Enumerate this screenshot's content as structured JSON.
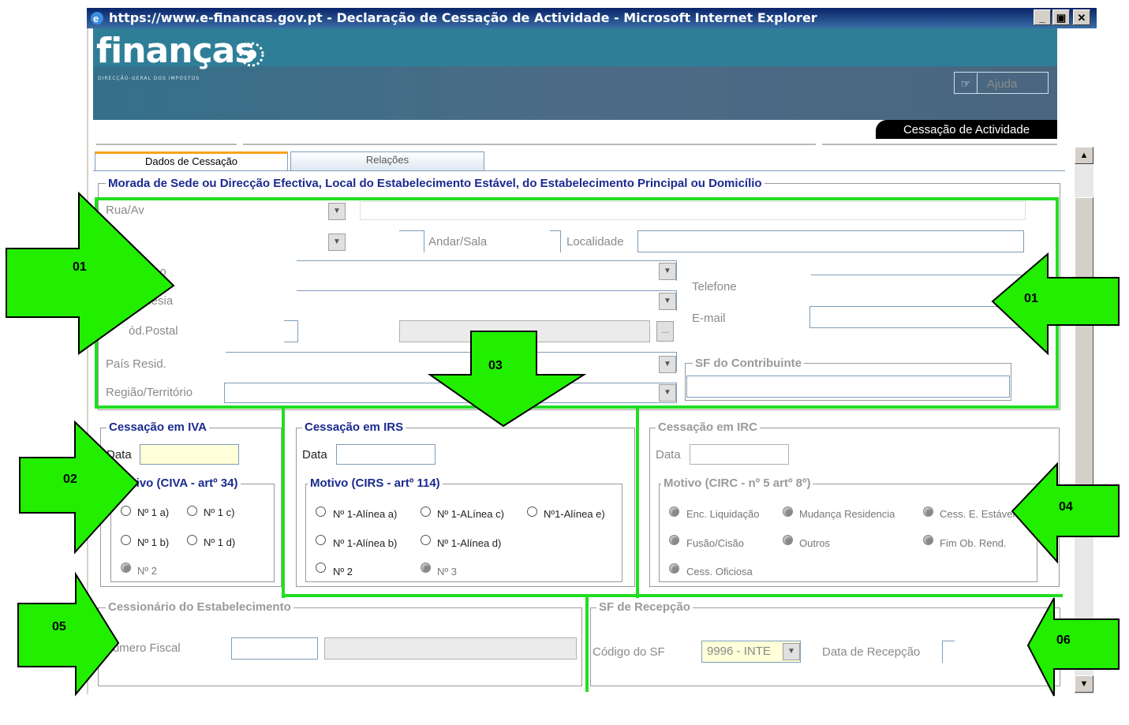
{
  "window": {
    "title": "https://www.e-financas.gov.pt - Declaração de Cessação de Actividade - Microsoft Internet Explorer",
    "minimize": "_",
    "maximize": "▣",
    "close": "✕"
  },
  "banner": {
    "logo": "finanças",
    "logo_sub": "DIRECÇÃO-GERAL DOS IMPOSTOS",
    "help_label": "Ajuda",
    "section": "Cessação de Actividade"
  },
  "tabs": [
    {
      "label": "Dados de Cessação",
      "active": true
    },
    {
      "label": "Relações",
      "active": false
    }
  ],
  "morada": {
    "legend": "Morada de Sede ou Direcção Efectiva, Local do Estabelecimento Estável, do Estabelecimento Principal ou Domicílio",
    "rua": "Rua/Av",
    "n": "º,...",
    "andar": "Andar/Sala",
    "localidade": "Localidade",
    "concelho": "celho",
    "freguesia": "guesia",
    "cod_postal": "ód.Postal",
    "pais": "País Resid.",
    "regiao": "Região/Território",
    "telefone": "Telefone",
    "email": "E-mail",
    "sf_legend": "SF do Contribuinte"
  },
  "iva": {
    "legend": "Cessação em IVA",
    "data_label": "Data",
    "motivo_legend": "Motivo (CIVA - artº 34)",
    "options": [
      "Nº 1 a)",
      "Nº 1 c)",
      "Nº 1 b)",
      "Nº 1 d)",
      "Nº 2"
    ]
  },
  "irs": {
    "legend": "Cessação em IRS",
    "data_label": "Data",
    "motivo_legend": "Motivo (CIRS - artº 114)",
    "options": [
      "Nº 1-Alínea a)",
      "Nº 1-ALínea c)",
      "Nº1-Alínea e)",
      "Nº 1-Alínea b)",
      "Nº 1-Alínea d)",
      "Nº 2",
      "Nº 3"
    ]
  },
  "irc": {
    "legend": "Cessação em IRC",
    "data_label": "Data",
    "motivo_legend": "Motivo (CIRC - nº 5 artº 8º)",
    "options": [
      "Enc. Liquidação",
      "Mudança Residencia",
      "Cess. E. Estável",
      "Fusão/Cisão",
      "Outros",
      "Fim Ob. Rend.",
      "Cess. Oficiosa"
    ]
  },
  "cessionario": {
    "legend": "Cessionário do Estabelecimento",
    "numero_fiscal": "Número Fiscal"
  },
  "recepcao": {
    "legend": "SF de Recepção",
    "codigo_label": "Código do SF",
    "codigo_value": "9996 - INTE",
    "data_label": "Data de Recepção"
  },
  "annotations": [
    "01",
    "01",
    "02",
    "03",
    "04",
    "05",
    "06"
  ],
  "colors": {
    "highlight": "#22dd22",
    "arrow": "#22ee00",
    "legend": "#1b2a8f",
    "tab_accent": "#f8a31b"
  }
}
